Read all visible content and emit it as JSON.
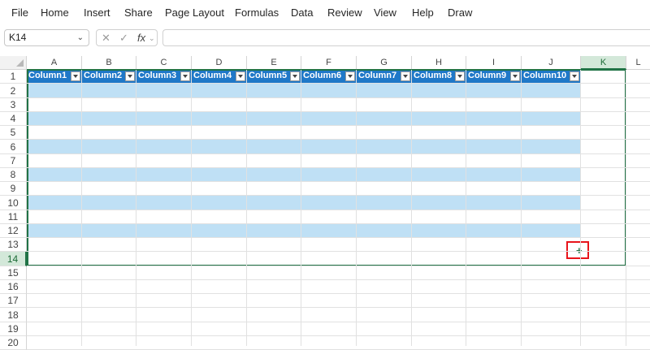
{
  "menu": {
    "items": [
      "File",
      "Home",
      "Insert",
      "Share",
      "Page Layout",
      "Formulas",
      "Data",
      "Review",
      "View",
      "Help",
      "Draw"
    ]
  },
  "formula_bar": {
    "name_box": "K14",
    "formula": "",
    "cancel_icon": "✕",
    "enter_icon": "✓",
    "fx_label": "fx"
  },
  "grid": {
    "columns": [
      "A",
      "B",
      "C",
      "D",
      "E",
      "F",
      "G",
      "H",
      "I",
      "J",
      "K",
      "L"
    ],
    "rows": [
      "1",
      "2",
      "3",
      "4",
      "5",
      "6",
      "7",
      "8",
      "9",
      "10",
      "11",
      "12",
      "13",
      "14",
      "15",
      "16",
      "17",
      "18",
      "19",
      "20"
    ],
    "selected_column": "K",
    "selected_row": "14",
    "table_headers": [
      "Column1",
      "Column2",
      "Column3",
      "Column4",
      "Column5",
      "Column6",
      "Column7",
      "Column8",
      "Column9",
      "Column10"
    ]
  },
  "colors": {
    "accent": "#217346",
    "table_header": "#1f78c8",
    "band": "#bfe0f5",
    "highlight": "#e8141b"
  }
}
